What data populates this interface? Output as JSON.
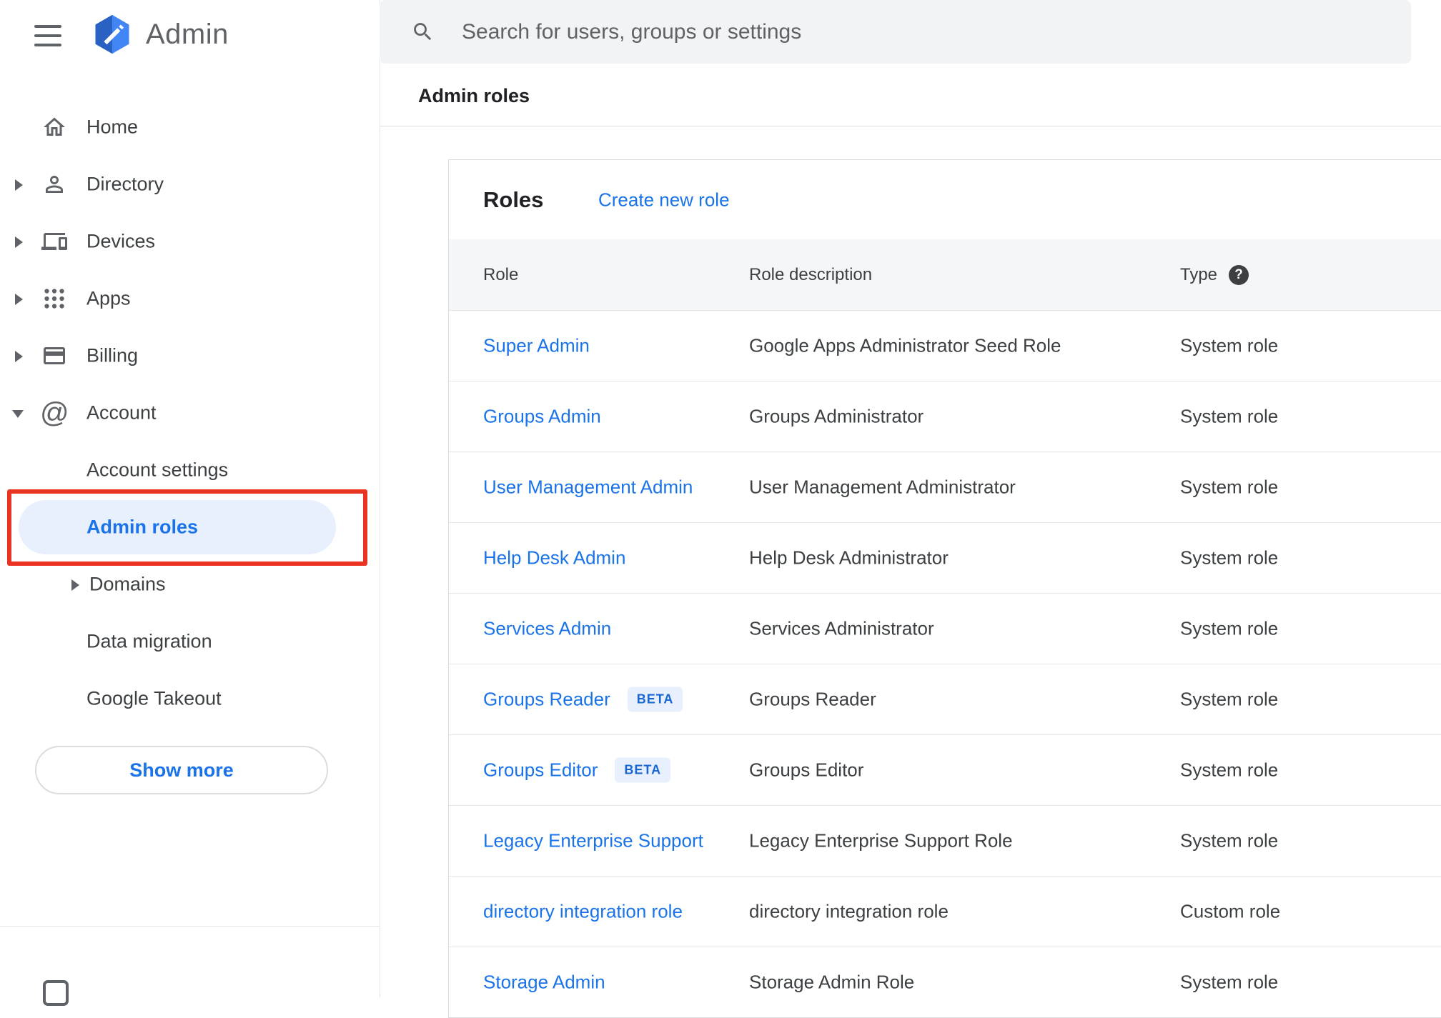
{
  "app": {
    "name": "Admin"
  },
  "search": {
    "placeholder": "Search for users, groups or settings"
  },
  "page": {
    "breadcrumb": "Admin roles"
  },
  "icons": {
    "menu": "hamburger",
    "logo": "admin-hexagon",
    "search_glyph": "magnifier",
    "account_glyph": "@",
    "help_glyph": "?"
  },
  "sidebar": {
    "items": [
      {
        "label": "Home",
        "icon": "home-icon",
        "expandable": false
      },
      {
        "label": "Directory",
        "icon": "person-icon",
        "expandable": true
      },
      {
        "label": "Devices",
        "icon": "devices-icon",
        "expandable": true
      },
      {
        "label": "Apps",
        "icon": "apps-grid-icon",
        "expandable": true
      },
      {
        "label": "Billing",
        "icon": "credit-card-icon",
        "expandable": true
      },
      {
        "label": "Account",
        "icon": "at-icon",
        "expanded": true
      }
    ],
    "account_children": [
      {
        "label": "Account settings"
      },
      {
        "label": "Admin roles",
        "selected": true
      },
      {
        "label": "Domains",
        "expandable": true
      },
      {
        "label": "Data migration"
      },
      {
        "label": "Google Takeout"
      }
    ],
    "show_more": "Show more"
  },
  "roles_panel": {
    "title": "Roles",
    "create_link": "Create new role",
    "columns": {
      "role": "Role",
      "description": "Role description",
      "type": "Type"
    },
    "rows": [
      {
        "role": "Super Admin",
        "description": "Google Apps Administrator Seed Role",
        "type": "System role"
      },
      {
        "role": "Groups Admin",
        "description": "Groups Administrator",
        "type": "System role"
      },
      {
        "role": "User Management Admin",
        "description": "User Management Administrator",
        "type": "System role"
      },
      {
        "role": "Help Desk Admin",
        "description": "Help Desk Administrator",
        "type": "System role"
      },
      {
        "role": "Services Admin",
        "description": "Services Administrator",
        "type": "System role"
      },
      {
        "role": "Groups Reader",
        "badge": "BETA",
        "description": "Groups Reader",
        "type": "System role"
      },
      {
        "role": "Groups Editor",
        "badge": "BETA",
        "description": "Groups Editor",
        "type": "System role"
      },
      {
        "role": "Legacy Enterprise Support",
        "description": "Legacy Enterprise Support Role",
        "type": "System role"
      },
      {
        "role": "directory integration role",
        "description": "directory integration role",
        "type": "Custom role"
      },
      {
        "role": "Storage Admin",
        "description": "Storage Admin Role",
        "type": "System role"
      }
    ]
  },
  "colors": {
    "link_blue": "#1a73e8",
    "selected_item_bg": "#e8f0fe",
    "annotation_red": "#ea3323",
    "badge_bg": "#e8f0fe",
    "badge_text": "#1967d2",
    "search_bg": "#f1f3f4",
    "table_header_bg": "#f5f6f7",
    "icon_gray": "#5f6368"
  }
}
